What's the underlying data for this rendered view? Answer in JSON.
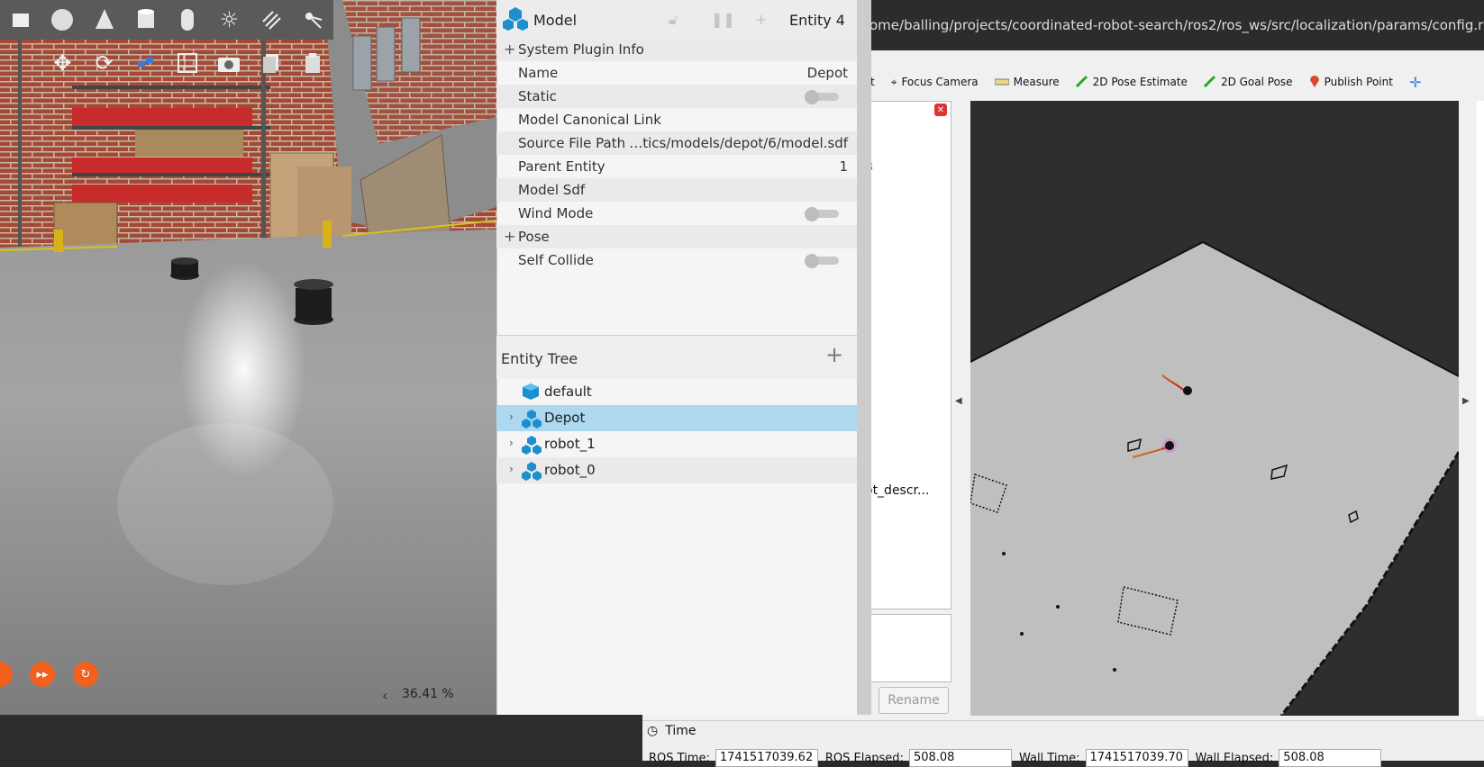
{
  "rviz": {
    "window_title": "ome/balling/projects/coordinated-robot-search/ros2/ros_ws/src/localization/params/config.rviz* -",
    "toolbar": [
      {
        "label": "ect",
        "icon": "interact-icon"
      },
      {
        "label": "Focus Camera",
        "icon": "focus-camera-icon"
      },
      {
        "label": "Measure",
        "icon": "ruler-icon"
      },
      {
        "label": "2D Pose Estimate",
        "icon": "green-arrow-icon"
      },
      {
        "label": "2D Goal Pose",
        "icon": "green-arrow-icon"
      },
      {
        "label": "Publish Point",
        "icon": "map-pin-icon"
      }
    ],
    "partial_text_1": "3",
    "partial_text_2": "ot_descr...",
    "rename_label": "Rename",
    "time": {
      "title": "Time",
      "fields": [
        {
          "label": "ROS Time:",
          "value": "1741517039.62"
        },
        {
          "label": "ROS Elapsed:",
          "value": "508.08"
        },
        {
          "label": "Wall Time:",
          "value": "1741517039.70"
        },
        {
          "label": "Wall Elapsed:",
          "value": "508.08"
        }
      ]
    }
  },
  "gazebo": {
    "rtf": "36.41 %",
    "inspector": {
      "title": "Model",
      "entity": "Entity 4",
      "rows": [
        {
          "label": "System Plugin Info",
          "value": "",
          "type": "expander"
        },
        {
          "label": "Name",
          "value": "Depot",
          "type": "text"
        },
        {
          "label": "Static",
          "value": "",
          "type": "toggle",
          "on": false
        },
        {
          "label": "Model Canonical Link",
          "value": "",
          "type": "text"
        },
        {
          "label": "Source File Path",
          "value": "…tics/models/depot/6/model.sdf",
          "type": "text"
        },
        {
          "label": "Parent Entity",
          "value": "1",
          "type": "text"
        },
        {
          "label": "Model Sdf",
          "value": "",
          "type": "text"
        },
        {
          "label": "Wind Mode",
          "value": "",
          "type": "toggle",
          "on": false
        },
        {
          "label": "Pose",
          "value": "",
          "type": "expander"
        },
        {
          "label": "Self Collide",
          "value": "",
          "type": "toggle",
          "on": false
        }
      ]
    },
    "entity_tree": {
      "title": "Entity Tree",
      "items": [
        {
          "label": "default",
          "selected": false,
          "expandable": false
        },
        {
          "label": "Depot",
          "selected": true,
          "expandable": true
        },
        {
          "label": "robot_1",
          "selected": false,
          "expandable": true
        },
        {
          "label": "robot_0",
          "selected": false,
          "expandable": true
        }
      ]
    }
  },
  "colors": {
    "selection": "#add8f0",
    "accent_orange": "#f2601e",
    "rviz_green": "#22aa22"
  }
}
